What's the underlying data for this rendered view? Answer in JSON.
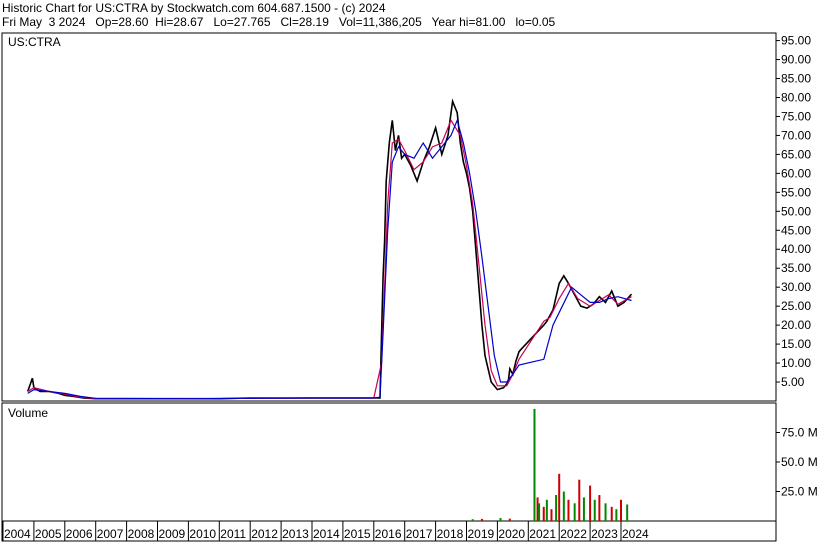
{
  "header": {
    "line1": "Historic Chart for US:CTRA by Stockwatch.com 604.687.1500 - (c) 2024",
    "line2": "Fri May  3 2024   Op=28.60  Hi=28.67   Lo=27.765   Cl=28.19   Vol=11,386,205   Year hi=81.00   lo=0.05"
  },
  "chart_data": [
    {
      "type": "line",
      "title": "US:CTRA",
      "panel": "price",
      "ylim": [
        0,
        97
      ],
      "yticks": [
        "95.00",
        "90.00",
        "85.00",
        "80.00",
        "75.00",
        "70.00",
        "65.00",
        "60.00",
        "55.00",
        "50.00",
        "45.00",
        "40.00",
        "35.00",
        "30.00",
        "25.00",
        "20.00",
        "15.00",
        "10.00",
        "5.00"
      ],
      "xticks": [
        "2004",
        "2005",
        "2006",
        "2007",
        "2008",
        "2009",
        "2010",
        "2011",
        "2012",
        "2013",
        "2014",
        "2015",
        "2016",
        "2017",
        "2018",
        "2019",
        "2020",
        "2021",
        "2022",
        "2023",
        "2024"
      ],
      "grid": false,
      "series": [
        {
          "color": "#000000",
          "x": [
            2004.8,
            2004.95,
            2005.0,
            2005.2,
            2005.5,
            2005.8,
            2006.0,
            2006.3,
            2006.6,
            2007.0,
            2008.0,
            2009.0,
            2010.0,
            2011.0,
            2012.0,
            2013.0,
            2014.0,
            2015.0,
            2016.0,
            2016.2,
            2016.25,
            2016.3,
            2016.35,
            2016.4,
            2016.5,
            2016.6,
            2016.7,
            2016.8,
            2016.9,
            2017.0,
            2017.2,
            2017.4,
            2017.6,
            2017.8,
            2018.0,
            2018.2,
            2018.4,
            2018.55,
            2018.7,
            2018.8,
            2018.9,
            2019.0,
            2019.1,
            2019.2,
            2019.3,
            2019.4,
            2019.5,
            2019.6,
            2019.8,
            2020.0,
            2020.2,
            2020.35,
            2020.4,
            2020.5,
            2020.6,
            2020.7,
            2020.75,
            2021.5,
            2021.6,
            2021.8,
            2022.0,
            2022.15,
            2022.3,
            2022.5,
            2022.7,
            2022.9,
            2023.1,
            2023.3,
            2023.5,
            2023.7,
            2023.9,
            2024.1,
            2024.34
          ],
          "y": [
            2.5,
            6.0,
            3.5,
            2.5,
            2.5,
            2.0,
            1.5,
            1.2,
            0.8,
            0.6,
            0.6,
            0.6,
            0.6,
            0.6,
            0.8,
            0.8,
            0.8,
            0.8,
            0.8,
            0.8,
            17.0,
            33.0,
            42.0,
            58.0,
            68.0,
            74.0,
            66.0,
            70.0,
            64.0,
            65.0,
            62.0,
            58.0,
            63.0,
            67.0,
            72.0,
            65.0,
            70.0,
            79.0,
            76.0,
            68.0,
            63.0,
            60.0,
            56.0,
            50.0,
            40.0,
            30.0,
            20.0,
            12.0,
            5.0,
            3.0,
            3.5,
            5.0,
            8.5,
            7.0,
            10.5,
            13.0,
            13.5,
            20.0,
            21.0,
            24.0,
            31.0,
            33.0,
            31.0,
            28.0,
            25.0,
            24.5,
            25.5,
            27.5,
            26.0,
            29.0,
            25.0,
            26.0,
            28.19
          ]
        },
        {
          "color": "#cc0055",
          "x": [
            2004.8,
            2005.0,
            2005.5,
            2006.0,
            2006.5,
            2007.0,
            2010.0,
            2014.0,
            2016.0,
            2016.25,
            2016.35,
            2016.45,
            2016.6,
            2016.8,
            2017.0,
            2017.3,
            2017.6,
            2017.9,
            2018.2,
            2018.5,
            2018.8,
            2019.0,
            2019.2,
            2019.4,
            2019.6,
            2019.8,
            2020.0,
            2020.3,
            2020.5,
            2020.7,
            2021.5,
            2021.7,
            2022.0,
            2022.3,
            2022.6,
            2023.0,
            2023.3,
            2023.6,
            2023.9,
            2024.34
          ],
          "y": [
            2.5,
            3.5,
            2.5,
            1.8,
            1.0,
            0.6,
            0.6,
            0.8,
            0.8,
            10.0,
            30.0,
            52.0,
            68.0,
            69.0,
            66.0,
            61.0,
            63.0,
            67.0,
            68.0,
            74.0,
            70.0,
            62.0,
            52.0,
            36.0,
            20.0,
            8.0,
            4.0,
            4.0,
            7.0,
            11.0,
            21.0,
            22.0,
            27.0,
            31.0,
            27.0,
            25.0,
            26.5,
            28.0,
            25.5,
            27.5
          ]
        },
        {
          "color": "#0000cc",
          "x": [
            2004.8,
            2005.0,
            2005.5,
            2006.0,
            2006.5,
            2007.0,
            2010.0,
            2014.0,
            2016.0,
            2016.2,
            2016.3,
            2016.45,
            2016.6,
            2016.8,
            2017.0,
            2017.3,
            2017.6,
            2017.9,
            2018.2,
            2018.5,
            2018.7,
            2018.9,
            2019.1,
            2019.3,
            2019.5,
            2019.7,
            2019.9,
            2020.1,
            2020.3,
            2020.5,
            2020.7,
            2021.5,
            2021.8,
            2022.1,
            2022.4,
            2022.7,
            2023.0,
            2023.3,
            2023.6,
            2023.9,
            2024.34
          ],
          "y": [
            2.0,
            3.0,
            2.5,
            2.0,
            1.2,
            0.7,
            0.6,
            0.8,
            0.8,
            1.0,
            18.0,
            45.0,
            63.0,
            67.0,
            65.0,
            64.0,
            68.0,
            64.0,
            67.0,
            70.0,
            74.0,
            68.0,
            60.0,
            50.0,
            38.0,
            25.0,
            12.0,
            5.0,
            5.0,
            7.0,
            9.5,
            11.0,
            20.0,
            25.0,
            30.0,
            28.0,
            26.0,
            26.0,
            27.0,
            27.5,
            26.5
          ]
        }
      ]
    },
    {
      "type": "bar",
      "title": "Volume",
      "panel": "volume",
      "ylim": [
        0,
        100
      ],
      "yticks": [
        "75.0 M",
        "50.0 M",
        "25.0 M"
      ],
      "x": [
        2019.2,
        2019.5,
        2020.1,
        2020.4,
        2021.2,
        2021.3,
        2021.35,
        2021.5,
        2021.6,
        2021.75,
        2021.9,
        2022.0,
        2022.15,
        2022.3,
        2022.5,
        2022.65,
        2022.8,
        2023.0,
        2023.15,
        2023.3,
        2023.5,
        2023.7,
        2023.85,
        2024.0,
        2024.2
      ],
      "values": [
        1.5,
        1.8,
        2.5,
        2.0,
        95.0,
        20.0,
        15.0,
        12.0,
        18.0,
        10.0,
        22.0,
        40.0,
        25.0,
        18.0,
        15.0,
        35.0,
        20.0,
        30.0,
        18.0,
        22.0,
        15.0,
        12.0,
        10.0,
        18.0,
        14.0
      ],
      "colors": [
        "#008800",
        "#cc0000",
        "#008800",
        "#cc0000",
        "#008800",
        "#cc0000",
        "#008800",
        "#cc0000",
        "#008800",
        "#cc0000",
        "#008800",
        "#cc0000",
        "#008800",
        "#cc0000",
        "#008800",
        "#cc0000",
        "#008800",
        "#cc0000",
        "#008800",
        "#cc0000",
        "#008800",
        "#cc0000",
        "#008800",
        "#cc0000",
        "#008800"
      ]
    }
  ]
}
